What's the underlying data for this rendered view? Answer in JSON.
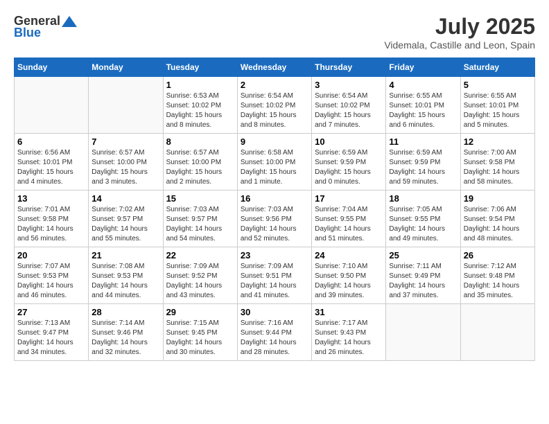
{
  "header": {
    "logo_general": "General",
    "logo_blue": "Blue",
    "month_title": "July 2025",
    "location": "Videmala, Castille and Leon, Spain"
  },
  "weekdays": [
    "Sunday",
    "Monday",
    "Tuesday",
    "Wednesday",
    "Thursday",
    "Friday",
    "Saturday"
  ],
  "weeks": [
    [
      {
        "day": "",
        "info": ""
      },
      {
        "day": "",
        "info": ""
      },
      {
        "day": "1",
        "info": "Sunrise: 6:53 AM\nSunset: 10:02 PM\nDaylight: 15 hours\nand 8 minutes."
      },
      {
        "day": "2",
        "info": "Sunrise: 6:54 AM\nSunset: 10:02 PM\nDaylight: 15 hours\nand 8 minutes."
      },
      {
        "day": "3",
        "info": "Sunrise: 6:54 AM\nSunset: 10:02 PM\nDaylight: 15 hours\nand 7 minutes."
      },
      {
        "day": "4",
        "info": "Sunrise: 6:55 AM\nSunset: 10:01 PM\nDaylight: 15 hours\nand 6 minutes."
      },
      {
        "day": "5",
        "info": "Sunrise: 6:55 AM\nSunset: 10:01 PM\nDaylight: 15 hours\nand 5 minutes."
      }
    ],
    [
      {
        "day": "6",
        "info": "Sunrise: 6:56 AM\nSunset: 10:01 PM\nDaylight: 15 hours\nand 4 minutes."
      },
      {
        "day": "7",
        "info": "Sunrise: 6:57 AM\nSunset: 10:00 PM\nDaylight: 15 hours\nand 3 minutes."
      },
      {
        "day": "8",
        "info": "Sunrise: 6:57 AM\nSunset: 10:00 PM\nDaylight: 15 hours\nand 2 minutes."
      },
      {
        "day": "9",
        "info": "Sunrise: 6:58 AM\nSunset: 10:00 PM\nDaylight: 15 hours\nand 1 minute."
      },
      {
        "day": "10",
        "info": "Sunrise: 6:59 AM\nSunset: 9:59 PM\nDaylight: 15 hours\nand 0 minutes."
      },
      {
        "day": "11",
        "info": "Sunrise: 6:59 AM\nSunset: 9:59 PM\nDaylight: 14 hours\nand 59 minutes."
      },
      {
        "day": "12",
        "info": "Sunrise: 7:00 AM\nSunset: 9:58 PM\nDaylight: 14 hours\nand 58 minutes."
      }
    ],
    [
      {
        "day": "13",
        "info": "Sunrise: 7:01 AM\nSunset: 9:58 PM\nDaylight: 14 hours\nand 56 minutes."
      },
      {
        "day": "14",
        "info": "Sunrise: 7:02 AM\nSunset: 9:57 PM\nDaylight: 14 hours\nand 55 minutes."
      },
      {
        "day": "15",
        "info": "Sunrise: 7:03 AM\nSunset: 9:57 PM\nDaylight: 14 hours\nand 54 minutes."
      },
      {
        "day": "16",
        "info": "Sunrise: 7:03 AM\nSunset: 9:56 PM\nDaylight: 14 hours\nand 52 minutes."
      },
      {
        "day": "17",
        "info": "Sunrise: 7:04 AM\nSunset: 9:55 PM\nDaylight: 14 hours\nand 51 minutes."
      },
      {
        "day": "18",
        "info": "Sunrise: 7:05 AM\nSunset: 9:55 PM\nDaylight: 14 hours\nand 49 minutes."
      },
      {
        "day": "19",
        "info": "Sunrise: 7:06 AM\nSunset: 9:54 PM\nDaylight: 14 hours\nand 48 minutes."
      }
    ],
    [
      {
        "day": "20",
        "info": "Sunrise: 7:07 AM\nSunset: 9:53 PM\nDaylight: 14 hours\nand 46 minutes."
      },
      {
        "day": "21",
        "info": "Sunrise: 7:08 AM\nSunset: 9:53 PM\nDaylight: 14 hours\nand 44 minutes."
      },
      {
        "day": "22",
        "info": "Sunrise: 7:09 AM\nSunset: 9:52 PM\nDaylight: 14 hours\nand 43 minutes."
      },
      {
        "day": "23",
        "info": "Sunrise: 7:09 AM\nSunset: 9:51 PM\nDaylight: 14 hours\nand 41 minutes."
      },
      {
        "day": "24",
        "info": "Sunrise: 7:10 AM\nSunset: 9:50 PM\nDaylight: 14 hours\nand 39 minutes."
      },
      {
        "day": "25",
        "info": "Sunrise: 7:11 AM\nSunset: 9:49 PM\nDaylight: 14 hours\nand 37 minutes."
      },
      {
        "day": "26",
        "info": "Sunrise: 7:12 AM\nSunset: 9:48 PM\nDaylight: 14 hours\nand 35 minutes."
      }
    ],
    [
      {
        "day": "27",
        "info": "Sunrise: 7:13 AM\nSunset: 9:47 PM\nDaylight: 14 hours\nand 34 minutes."
      },
      {
        "day": "28",
        "info": "Sunrise: 7:14 AM\nSunset: 9:46 PM\nDaylight: 14 hours\nand 32 minutes."
      },
      {
        "day": "29",
        "info": "Sunrise: 7:15 AM\nSunset: 9:45 PM\nDaylight: 14 hours\nand 30 minutes."
      },
      {
        "day": "30",
        "info": "Sunrise: 7:16 AM\nSunset: 9:44 PM\nDaylight: 14 hours\nand 28 minutes."
      },
      {
        "day": "31",
        "info": "Sunrise: 7:17 AM\nSunset: 9:43 PM\nDaylight: 14 hours\nand 26 minutes."
      },
      {
        "day": "",
        "info": ""
      },
      {
        "day": "",
        "info": ""
      }
    ]
  ]
}
